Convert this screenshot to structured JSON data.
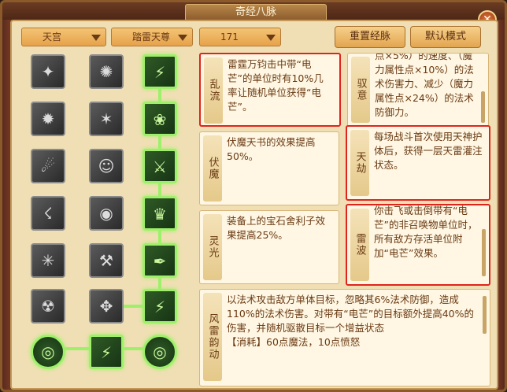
{
  "window": {
    "title": "奇经八脉"
  },
  "controls": {
    "school": "天宫",
    "faction": "踏雷天尊",
    "points": "171",
    "reset_label": "重置经脉",
    "default_label": "默认模式"
  },
  "cards": {
    "luanliu": {
      "label": "乱流",
      "text": "雷霆万钧击中带“电芒”的单位时有10%几率让随机单位获得“电芒”。"
    },
    "fumo": {
      "label": "伏魔",
      "text": "伏魔天书的效果提高50%。"
    },
    "lingguang": {
      "label": "灵光",
      "text": "装备上的宝石舍利子效果提高25%。"
    },
    "fengleiyun": {
      "label": "风雷韵动",
      "text": "以法术攻击敌方单体目标，忽略其6%法术防御，造成110%的法术伤害。对带有“电芒”的目标额外提高40%的伤害，并随机驱散目标一个增益状态",
      "cost": "【消耗】60点魔法，10点愤怒"
    },
    "yuyi": {
      "label": "驭意",
      "text": "点×5%）的速度、（魔力属性点×10%）的法术伤害力、减少（魔力属性点×24%）的法术防御力。"
    },
    "tianjie": {
      "label": "天劫",
      "text": "每场战斗首次使用天神护体后，获得一层天雷灌注状态。"
    },
    "leibo": {
      "label": "雷波",
      "text": "你击飞或击倒带有“电芒”的非召唤物单位时，所有敌方存活单位附加“电芒”效果。"
    }
  },
  "icons": {
    "close": "close-icon"
  }
}
